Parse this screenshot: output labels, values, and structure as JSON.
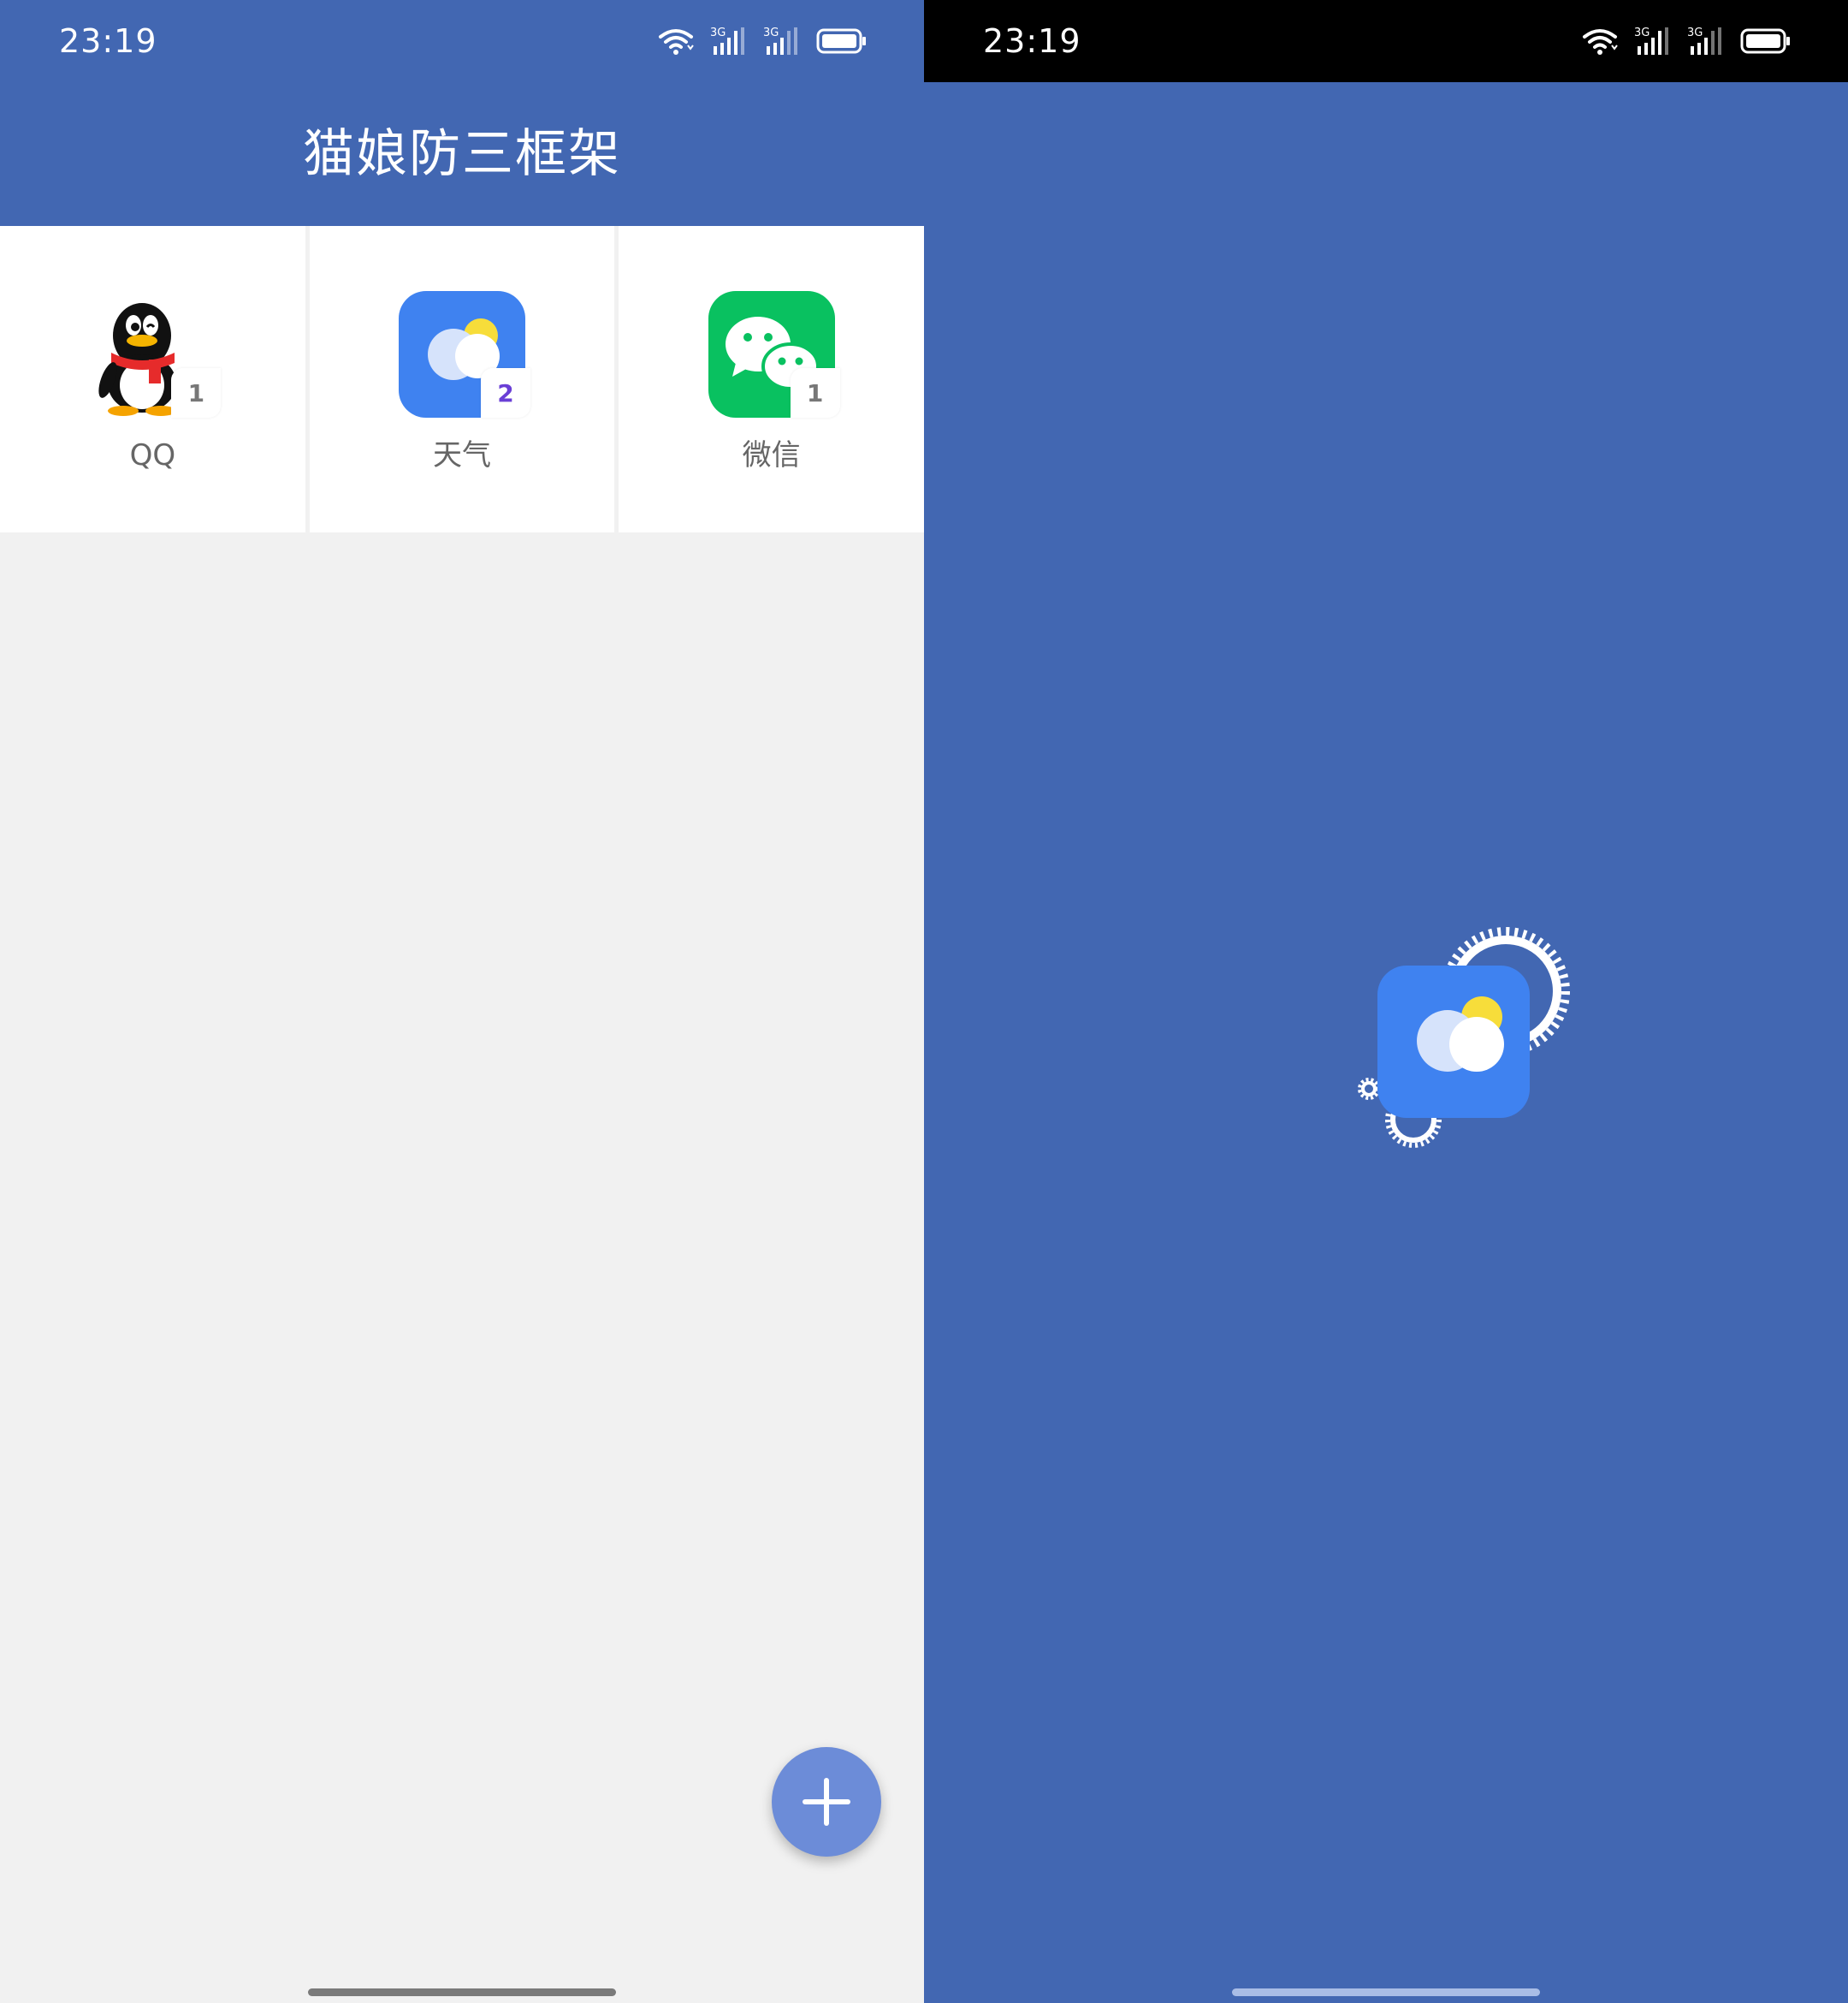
{
  "status_bar": {
    "time": "23:19",
    "wifi_icon": "wifi-icon",
    "signal_1_label": "3G",
    "signal_2_label": "3G",
    "battery_icon": "battery-icon"
  },
  "app": {
    "title": "猫娘防三框架"
  },
  "apps": [
    {
      "name": "QQ",
      "icon": "qq-penguin-icon",
      "count": "1"
    },
    {
      "name": "天气",
      "icon": "weather-icon",
      "count": "2"
    },
    {
      "name": "微信",
      "icon": "wechat-icon",
      "count": "1"
    }
  ],
  "fab": {
    "icon": "plus-icon"
  },
  "splash": {
    "icon": "weather-icon-with-gears"
  },
  "colors": {
    "primary": "#4267b2",
    "background": "#f1f1f1",
    "fab": "#6c8cd8",
    "weather_blue": "#3f82f0",
    "wechat_green": "#09c160",
    "badge_purple": "#6a3fd6"
  }
}
